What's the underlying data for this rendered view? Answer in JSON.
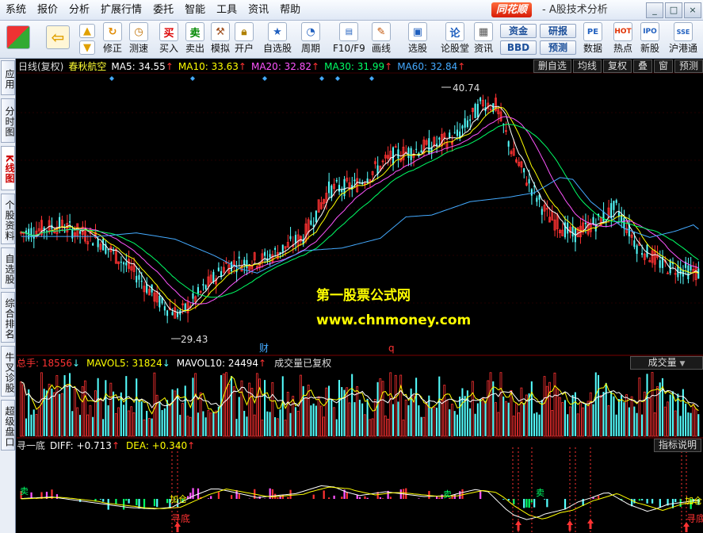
{
  "menu": [
    "系统",
    "报价",
    "分析",
    "扩展行情",
    "委托",
    "智能",
    "工具",
    "资讯",
    "帮助"
  ],
  "brand": {
    "logo": "同花顺",
    "subtitle": "- A股技术分析"
  },
  "window_buttons": [
    "_",
    "□",
    "×"
  ],
  "toolbar": {
    "buttons": [
      {
        "label": "修正",
        "icon": "refresh-icon"
      },
      {
        "label": "测速",
        "icon": "clock-icon"
      },
      {
        "label": "买入",
        "glyph": "买"
      },
      {
        "label": "卖出",
        "glyph": "卖"
      },
      {
        "label": "模拟",
        "icon": "hammer-icon"
      },
      {
        "label": "开户",
        "icon": "lock-icon"
      },
      {
        "label": "自选股",
        "icon": "star-icon"
      },
      {
        "label": "周期",
        "icon": "cycle-icon"
      },
      {
        "label": "F10/F9",
        "icon": "f10-icon"
      },
      {
        "label": "画线",
        "icon": "pencil-icon"
      },
      {
        "label": "选股",
        "icon": "screen-icon"
      },
      {
        "label": "论股堂",
        "glyph": "论"
      },
      {
        "label": "资讯",
        "icon": "news-icon"
      },
      {
        "label": "数据",
        "glyph": "PE"
      },
      {
        "label": "热点",
        "glyph": "HOT"
      },
      {
        "label": "新股",
        "glyph": "IPO"
      },
      {
        "label": "沪港通",
        "glyph": "SSE"
      }
    ],
    "pills": [
      "资金",
      "BBD",
      "研报",
      "预测"
    ]
  },
  "left_tabs": [
    "应用",
    "分时图",
    "K线图",
    "个股资料",
    "自选股",
    "综合排名",
    "牛叉诊股",
    "超级盘口"
  ],
  "kline": {
    "period_label": "日线(复权)",
    "stock_name": "春秋航空",
    "ma": [
      {
        "name": "MA5",
        "value": "34.55",
        "arrow": "↑",
        "color": "#ffffff"
      },
      {
        "name": "MA10",
        "value": "33.63",
        "arrow": "↑",
        "color": "#ffff00"
      },
      {
        "name": "MA20",
        "value": "32.82",
        "arrow": "↑",
        "color": "#ff55ff"
      },
      {
        "name": "MA30",
        "value": "31.99",
        "arrow": "↑",
        "color": "#00ff66"
      },
      {
        "name": "MA60",
        "value": "32.84",
        "arrow": "↑",
        "color": "#44aaff"
      }
    ],
    "right_buttons": [
      "删自选",
      "均线",
      "复权",
      "叠",
      "窗",
      "预测"
    ],
    "high_label": "40.74",
    "low_label": "29.43",
    "event_marks": [
      "财",
      "q"
    ]
  },
  "volume": {
    "total": "总手: 18556",
    "total_arrow": "↓",
    "mavol5": "MAVOL5: 31824",
    "mavol5_arrow": "↓",
    "mavol10": "MAVOL10: 24494",
    "mavol10_arrow": "↑",
    "note": "成交量已复权",
    "selector": "成交量"
  },
  "indicator": {
    "name": "寻一底",
    "diff": "DIFF: +0.713",
    "diff_arrow": "↑",
    "dea": "DEA: +0.340",
    "dea_arrow": "↑",
    "help": "指标说明",
    "signal_labels": [
      "寻底",
      "加仓",
      "寻底",
      "加仓",
      "卖",
      "卖",
      "卖"
    ]
  },
  "watermark": {
    "line1": "第一股票公式网",
    "line2": "www.chnmoney.com"
  },
  "colors": {
    "up": "#ff3232",
    "down": "#54ffff",
    "background": "#000000"
  }
}
